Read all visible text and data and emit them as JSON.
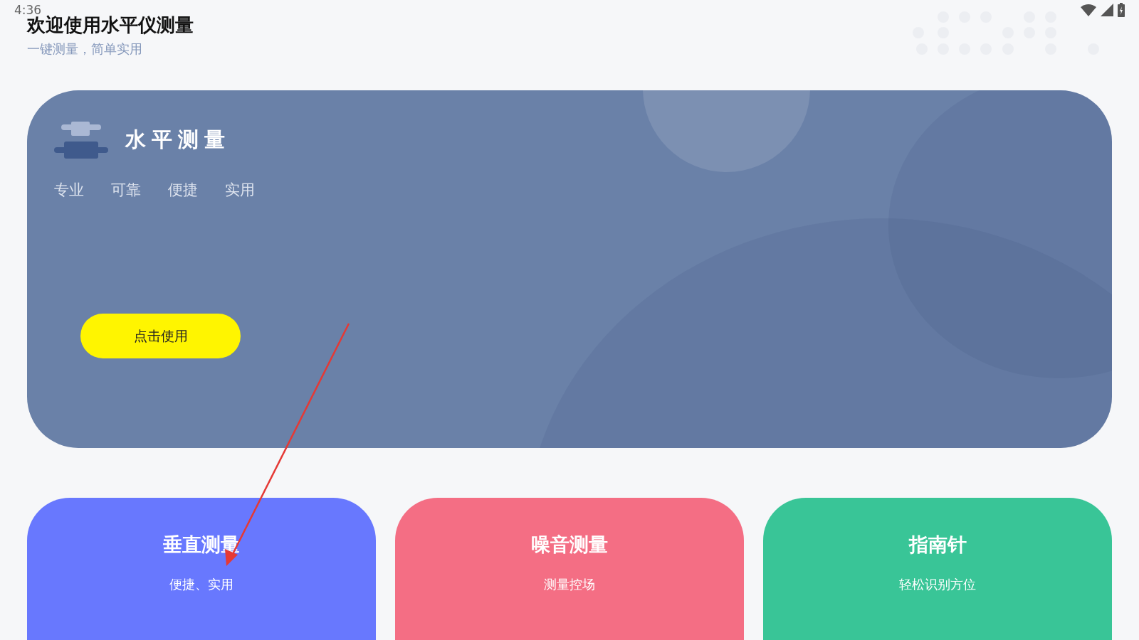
{
  "status_bar": {
    "time": "4:36"
  },
  "header": {
    "title": "欢迎使用水平仪测量",
    "subtitle": "一键测量，简单实用"
  },
  "hero": {
    "title": "水平测量",
    "tags": [
      "专业",
      "可靠",
      "便捷",
      "实用"
    ],
    "button": "点击使用"
  },
  "cards": [
    {
      "title": "垂直测量",
      "subtitle": "便捷、实用",
      "color": "#6878fe"
    },
    {
      "title": "噪音测量",
      "subtitle": "测量控场",
      "color": "#f46e84"
    },
    {
      "title": "指南针",
      "subtitle": "轻松识别方位",
      "color": "#39c597"
    }
  ]
}
